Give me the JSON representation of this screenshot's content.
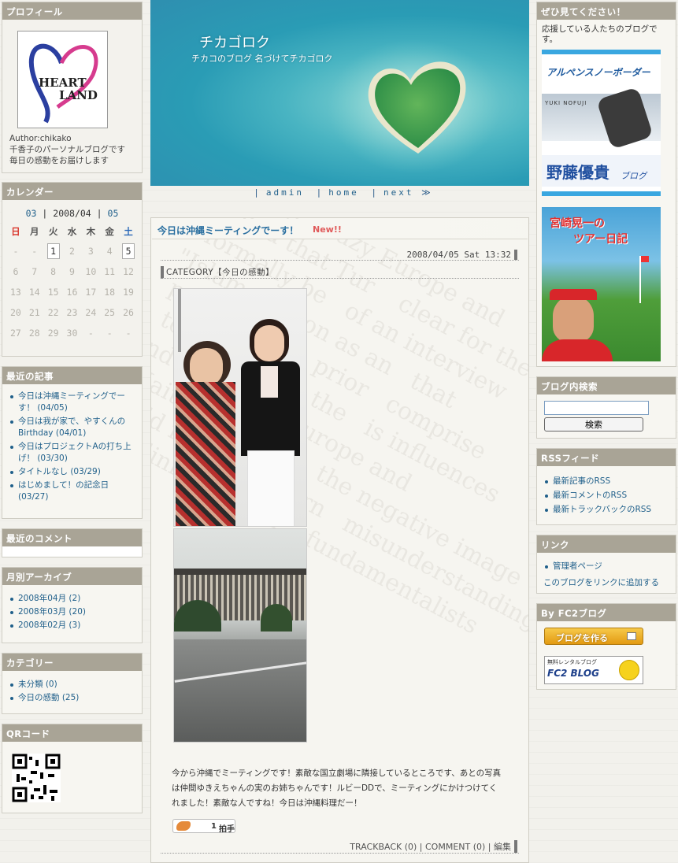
{
  "profile": {
    "title": "プロフィール",
    "logo_line1": "HEART",
    "logo_line2": "LAND",
    "author": "Author:chikako",
    "desc1": "千香子のパーソナルブログです",
    "desc2": "毎日の感動をお届けします"
  },
  "calendar": {
    "title": "カレンダー",
    "prev": "03",
    "current": "2008/04",
    "next": "05",
    "weekdays": [
      "日",
      "月",
      "火",
      "水",
      "木",
      "金",
      "土"
    ],
    "rows": [
      [
        "-",
        "-",
        "1",
        "2",
        "3",
        "4",
        "5"
      ],
      [
        "6",
        "7",
        "8",
        "9",
        "10",
        "11",
        "12"
      ],
      [
        "13",
        "14",
        "15",
        "16",
        "17",
        "18",
        "19"
      ],
      [
        "20",
        "21",
        "22",
        "23",
        "24",
        "25",
        "26"
      ],
      [
        "27",
        "28",
        "29",
        "30",
        "-",
        "-",
        "-"
      ]
    ]
  },
  "recent": {
    "title": "最近の記事",
    "items": [
      "今日は沖縄ミーティングでーす！ (04/05)",
      "今日は我が家で、やすくんのBirthday (04/01)",
      "今日はプロジェクトAの打ち上げ！ (03/30)",
      "タイトルなし (03/29)",
      "はじめまして！の記念日 (03/27)"
    ]
  },
  "comments": {
    "title": "最近のコメント"
  },
  "archive": {
    "title": "月別アーカイブ",
    "items": [
      "2008年04月 (2)",
      "2008年03月 (20)",
      "2008年02月 (3)"
    ]
  },
  "category": {
    "title": "カテゴリー",
    "items": [
      "未分類 (0)",
      "今日の感動 (25)"
    ]
  },
  "qr": {
    "title": "QRコード"
  },
  "header": {
    "title": "チカゴロク",
    "subtitle": "チカコのブログ 名づけてチカゴロク"
  },
  "nav": {
    "sep": "|",
    "admin": "admin",
    "home": "home",
    "next": "next",
    "arrow": "≫"
  },
  "post": {
    "title": "今日は沖縄ミーティングでーす！",
    "badge": "New!!",
    "date": "2008/04/05 Sat 13:32",
    "category": "CATEGORY【今日の感動】",
    "body": "今から沖縄でミーティングです！素敵な国立劇場に隣接しているところです、あとの写真は仲間ゆきえちゃんの実のお姉ちゃんです！ルビーDDで、ミーティングにかけつけてくれました！素敵な人ですね！今日は沖縄料理だー！",
    "clap_count": "1",
    "clap_label": "拍手",
    "trackback": "TRACKBACK (0)",
    "comment": "COMMENT (0)",
    "edit": "編集"
  },
  "right": {
    "mustsee_title": "ぜひ見てください！",
    "mustsee_text": "応援している人たちのブログです。",
    "banner1_title": "アルペンスノーボーダー",
    "banner1_name": "YUKI NOFUJI",
    "banner1_jp": "野藤優貴",
    "banner1_sub": "ブログ",
    "banner2_line1": "宮崎晃一の",
    "banner2_line2": "ツアー日記",
    "search_title": "ブログ内検索",
    "search_button": "検索",
    "rss_title": "RSSフィード",
    "rss_items": [
      "最新記事のRSS",
      "最新コメントのRSS",
      "最新トラックバックのRSS"
    ],
    "link_title": "リンク",
    "link_items": [
      "管理者ページ"
    ],
    "link_add": "このブログをリンクに追加する",
    "fc2_title": "By FC2ブログ",
    "fc2_make": "ブログを作る",
    "fc2_rental": "無料レンタルブログ",
    "fc2_logo": "FC2 BLOG"
  }
}
